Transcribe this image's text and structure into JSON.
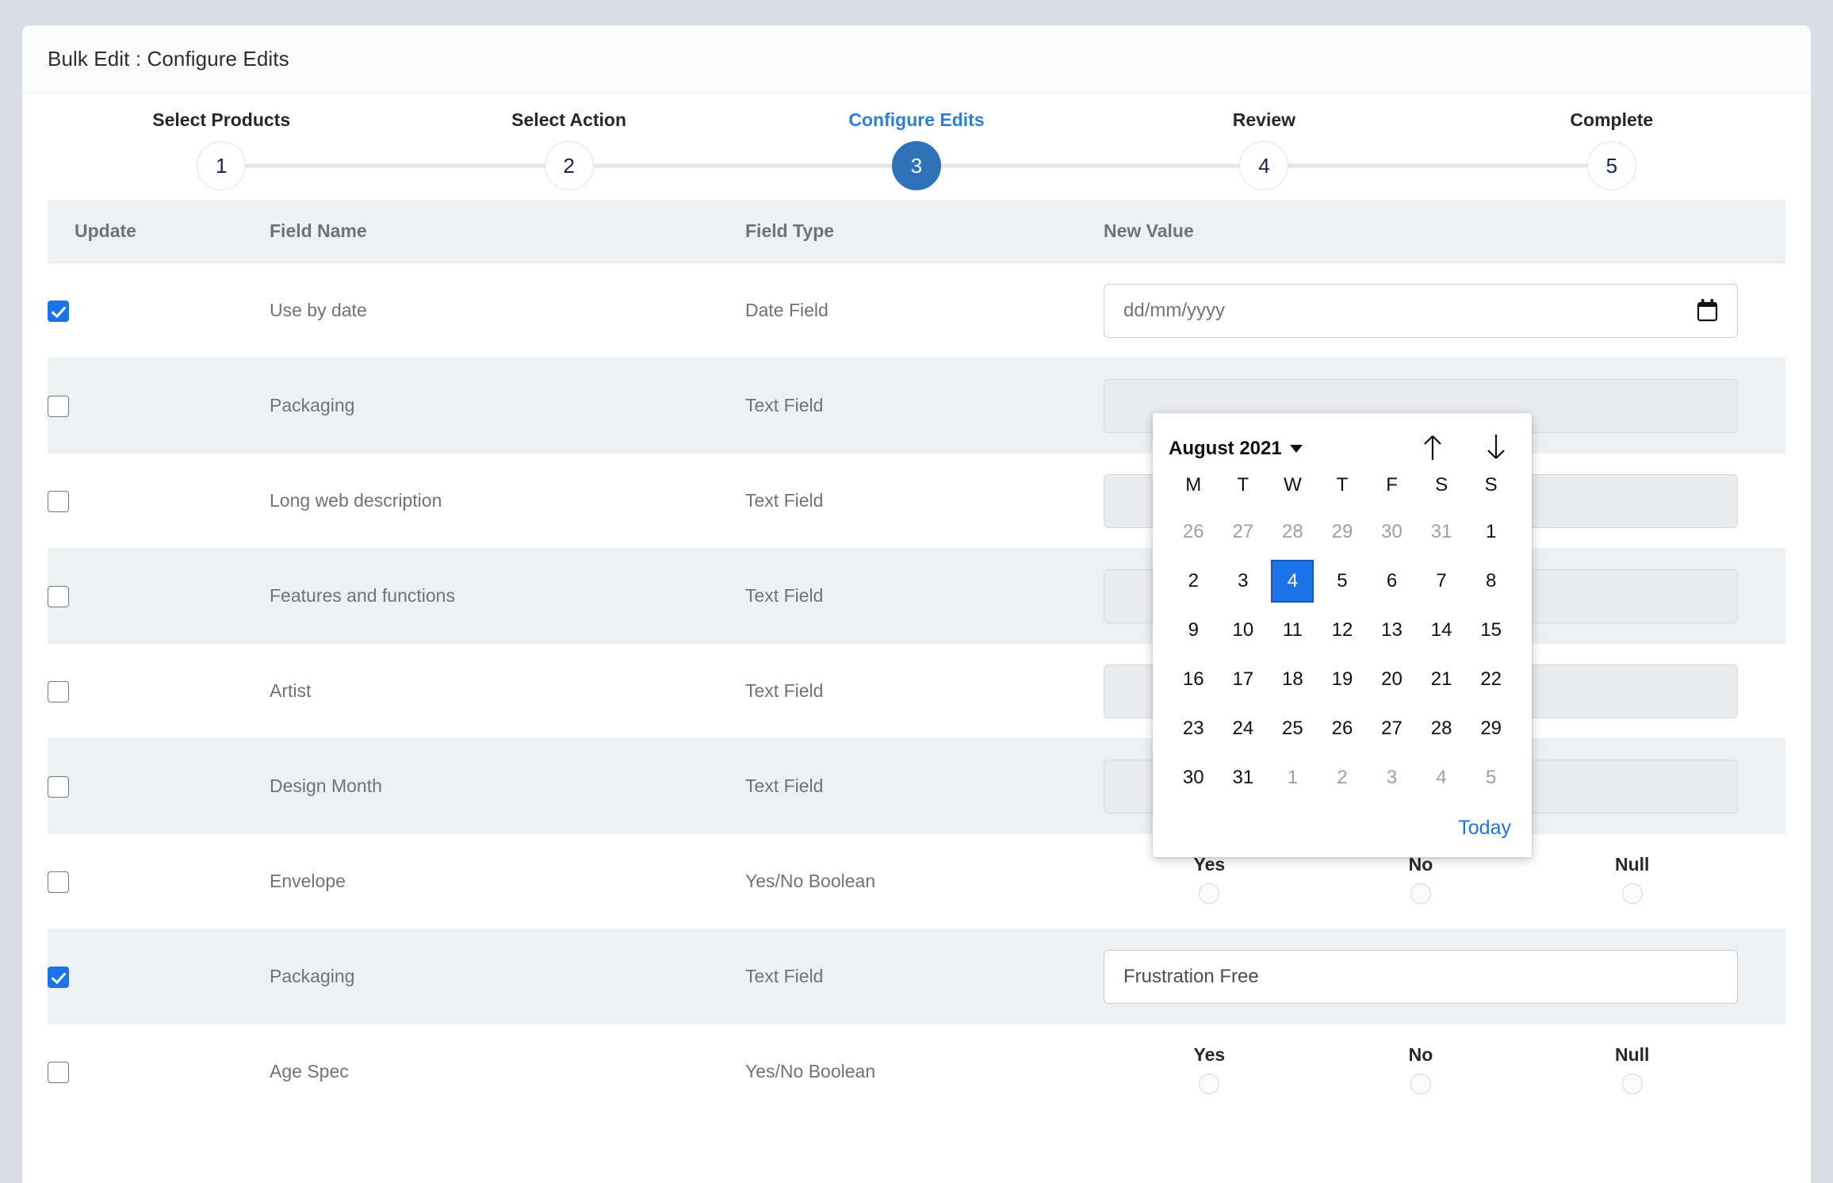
{
  "window": {
    "title": "Bulk Edit : Configure Edits"
  },
  "stepper": {
    "steps": [
      {
        "label": "Select Products",
        "number": "1",
        "active": false
      },
      {
        "label": "Select Action",
        "number": "2",
        "active": false
      },
      {
        "label": "Configure Edits",
        "number": "3",
        "active": true
      },
      {
        "label": "Review",
        "number": "4",
        "active": false
      },
      {
        "label": "Complete",
        "number": "5",
        "active": false
      }
    ]
  },
  "table": {
    "headers": {
      "update": "Update",
      "field_name": "Field Name",
      "field_type": "Field Type",
      "new_value": "New Value"
    },
    "rows": [
      {
        "checked": true,
        "name": "Use by date",
        "type": "Date Field",
        "control": "date",
        "value": "",
        "placeholder": "dd/mm/yyyy"
      },
      {
        "checked": false,
        "name": "Packaging",
        "type": "Text Field",
        "control": "text",
        "value": "",
        "placeholder": ""
      },
      {
        "checked": false,
        "name": "Long web description",
        "type": "Text Field",
        "control": "text",
        "value": "",
        "placeholder": ""
      },
      {
        "checked": false,
        "name": "Features and functions",
        "type": "Text Field",
        "control": "text",
        "value": "",
        "placeholder": ""
      },
      {
        "checked": false,
        "name": "Artist",
        "type": "Text Field",
        "control": "text",
        "value": "",
        "placeholder": ""
      },
      {
        "checked": false,
        "name": "Design Month",
        "type": "Text Field",
        "control": "text",
        "value": "",
        "placeholder": ""
      },
      {
        "checked": false,
        "name": "Envelope",
        "type": "Yes/No Boolean",
        "control": "bool",
        "value": "",
        "placeholder": ""
      },
      {
        "checked": true,
        "name": "Packaging",
        "type": "Text Field",
        "control": "text",
        "value": "Frustration Free",
        "placeholder": ""
      },
      {
        "checked": false,
        "name": "Age Spec",
        "type": "Yes/No Boolean",
        "control": "bool",
        "value": "",
        "placeholder": ""
      }
    ],
    "boolean_options": [
      "Yes",
      "No",
      "Null"
    ]
  },
  "datepicker": {
    "month_label": "August 2021",
    "prev_icon": "arrow-up-icon",
    "next_icon": "arrow-down-icon",
    "weekdays": [
      "M",
      "T",
      "W",
      "T",
      "F",
      "S",
      "S"
    ],
    "weeks": [
      [
        {
          "d": "26",
          "muted": true
        },
        {
          "d": "27",
          "muted": true
        },
        {
          "d": "28",
          "muted": true
        },
        {
          "d": "29",
          "muted": true
        },
        {
          "d": "30",
          "muted": true
        },
        {
          "d": "31",
          "muted": true
        },
        {
          "d": "1",
          "muted": false
        }
      ],
      [
        {
          "d": "2",
          "muted": false
        },
        {
          "d": "3",
          "muted": false
        },
        {
          "d": "4",
          "muted": false,
          "selected": true
        },
        {
          "d": "5",
          "muted": false
        },
        {
          "d": "6",
          "muted": false
        },
        {
          "d": "7",
          "muted": false
        },
        {
          "d": "8",
          "muted": false
        }
      ],
      [
        {
          "d": "9",
          "muted": false
        },
        {
          "d": "10",
          "muted": false
        },
        {
          "d": "11",
          "muted": false
        },
        {
          "d": "12",
          "muted": false
        },
        {
          "d": "13",
          "muted": false
        },
        {
          "d": "14",
          "muted": false
        },
        {
          "d": "15",
          "muted": false
        }
      ],
      [
        {
          "d": "16",
          "muted": false
        },
        {
          "d": "17",
          "muted": false
        },
        {
          "d": "18",
          "muted": false
        },
        {
          "d": "19",
          "muted": false
        },
        {
          "d": "20",
          "muted": false
        },
        {
          "d": "21",
          "muted": false
        },
        {
          "d": "22",
          "muted": false
        }
      ],
      [
        {
          "d": "23",
          "muted": false
        },
        {
          "d": "24",
          "muted": false
        },
        {
          "d": "25",
          "muted": false
        },
        {
          "d": "26",
          "muted": false
        },
        {
          "d": "27",
          "muted": false
        },
        {
          "d": "28",
          "muted": false
        },
        {
          "d": "29",
          "muted": false
        }
      ],
      [
        {
          "d": "30",
          "muted": false
        },
        {
          "d": "31",
          "muted": false
        },
        {
          "d": "1",
          "muted": true
        },
        {
          "d": "2",
          "muted": true
        },
        {
          "d": "3",
          "muted": true
        },
        {
          "d": "4",
          "muted": true
        },
        {
          "d": "5",
          "muted": true
        }
      ]
    ],
    "today_label": "Today",
    "selected_day": "4"
  },
  "colors": {
    "accent_blue": "#3072b8",
    "link_blue": "#1a73e8",
    "page_background": "#d9dde5",
    "row_alt": "#eef1f4",
    "header_background": "#eef1f4"
  }
}
